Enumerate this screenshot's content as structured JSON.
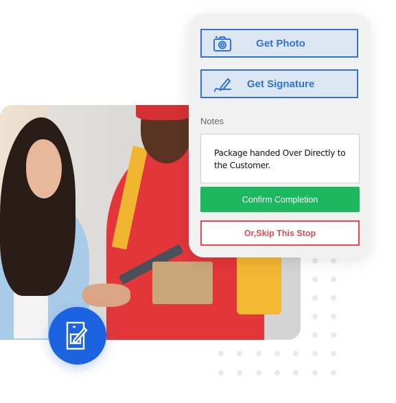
{
  "card": {
    "get_photo_label": "Get Photo",
    "get_signature_label": "Get Signature",
    "notes_label": "Notes",
    "notes_value": "Package handed Over Directly to the Customer.",
    "confirm_label": "Confirm Completion",
    "skip_label": "Or,Skip This Stop",
    "icons": {
      "photo": "camera-icon",
      "signature": "pen-signature-icon"
    }
  },
  "badge": {
    "icon": "tablet-pen-icon"
  },
  "photo": {
    "description": "delivery person handing package to customer signing on tablet"
  },
  "colors": {
    "primary_blue": "#2f72d9",
    "button_blue_bg": "#dde6f3",
    "confirm_green": "#1db760",
    "skip_red": "#ee4650",
    "badge_blue": "#1b63e0"
  }
}
